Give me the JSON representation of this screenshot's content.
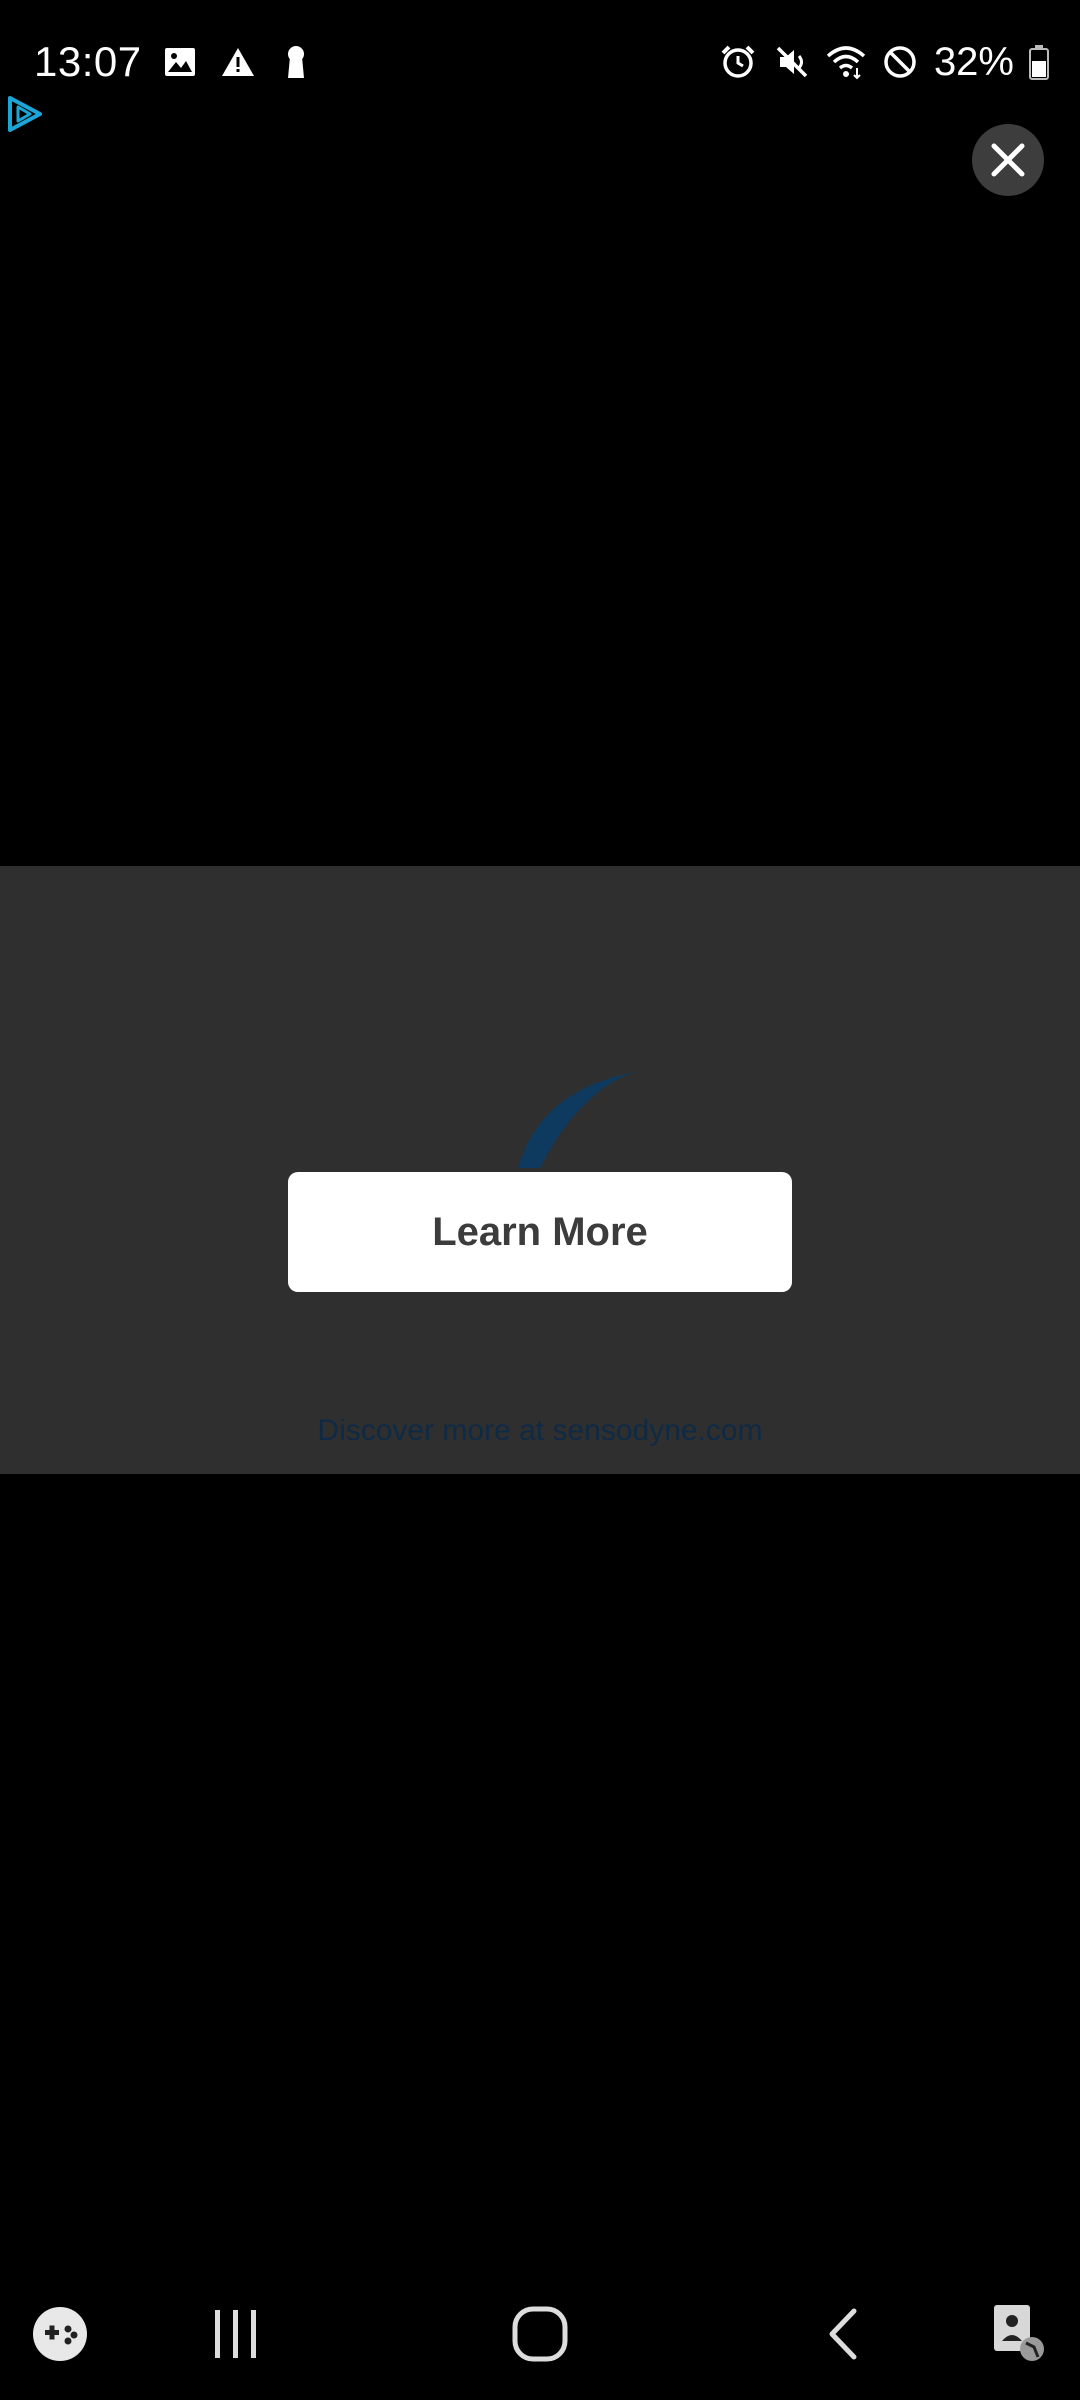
{
  "status_bar": {
    "time": "13:07",
    "battery_text": "32%",
    "left_icons": [
      "image-icon",
      "warning-icon",
      "keyhole-icon"
    ],
    "right_icons": [
      "alarm-icon",
      "mute-icon",
      "wifi-icon",
      "do-not-disturb-icon",
      "battery-icon"
    ]
  },
  "ad": {
    "marker_icon": "adchoices-play-icon",
    "close_icon": "close-icon",
    "cta_label": "Learn More",
    "footer_text": "Discover more at sensodyne.com"
  },
  "nav_bar": {
    "items": [
      "game-launcher-icon",
      "recents-icon",
      "home-icon",
      "back-icon",
      "accessibility-icon"
    ]
  },
  "colors": {
    "background": "#000000",
    "ad_panel": "#2f2f2f",
    "cta_background": "#ffffff",
    "cta_text": "#3c3c3c",
    "ad_marker": "#1aa7d8",
    "footer_text": "#0f2a44"
  }
}
